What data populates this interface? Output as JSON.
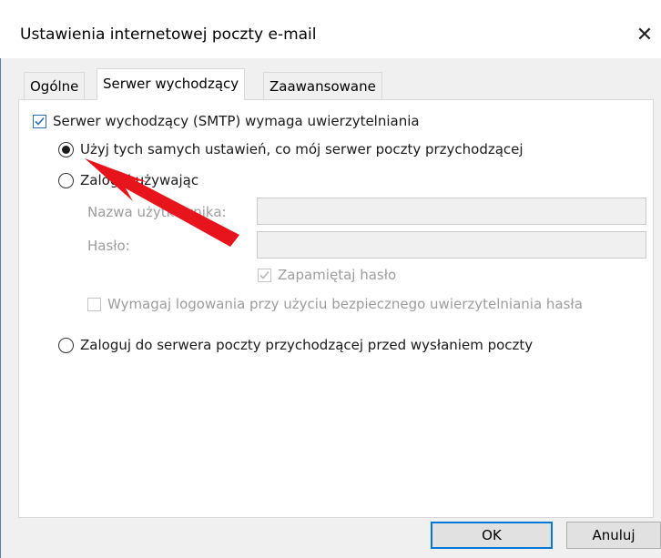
{
  "window": {
    "title": "Ustawienia internetowej poczty e-mail",
    "close_glyph": "✕"
  },
  "tabs": [
    {
      "label": "Ogólne",
      "active": false
    },
    {
      "label": "Serwer wychodzący",
      "active": true
    },
    {
      "label": "Zaawansowane",
      "active": false
    }
  ],
  "outgoing": {
    "requires_auth": {
      "label": "Serwer wychodzący (SMTP) wymaga uwierzytelniania",
      "checked": true
    },
    "options": [
      {
        "label": "Użyj tych samych ustawień, co mój serwer poczty przychodzącej",
        "selected": true
      },
      {
        "label": "Zaloguj używając",
        "selected": false
      },
      {
        "label": "Zaloguj do serwera poczty przychodzącej przed wysłaniem poczty",
        "selected": false
      }
    ],
    "username": {
      "label": "Nazwa użytkownika:",
      "value": ""
    },
    "password": {
      "label": "Hasło:",
      "value": ""
    },
    "remember_password": {
      "label": "Zapamiętaj hasło",
      "checked": true,
      "enabled": false
    },
    "require_spa": {
      "label": "Wymagaj logowania przy użyciu bezpiecznego uwierzytelniania hasła",
      "checked": false,
      "enabled": false
    }
  },
  "buttons": {
    "ok": "OK",
    "cancel": "Anuluj"
  },
  "colors": {
    "accent": "#0078d7",
    "annotation_arrow": "#e8141c"
  }
}
